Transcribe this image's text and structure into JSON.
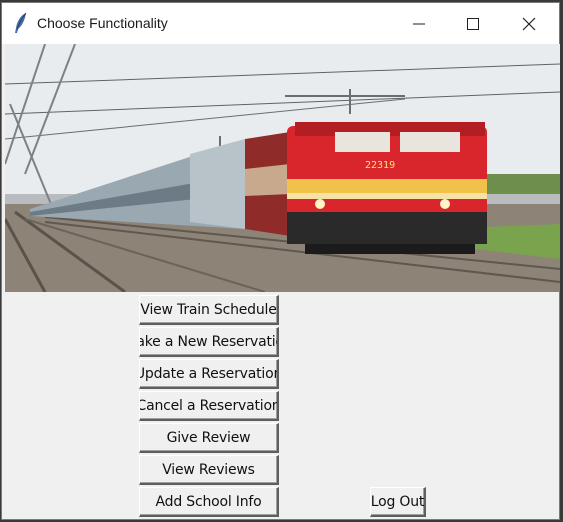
{
  "window": {
    "title": "Choose Functionality",
    "controls": {
      "minimize": "minimize-icon",
      "maximize": "maximize-icon",
      "close": "close-icon"
    }
  },
  "banner_image": {
    "alt_locomotive_number": "22319"
  },
  "menu": {
    "buttons": [
      {
        "label": "View Train Schedule"
      },
      {
        "label": "Make a New Reservation"
      },
      {
        "label": "Update a Reservation"
      },
      {
        "label": "Cancel a Reservation"
      },
      {
        "label": "Give Review"
      },
      {
        "label": "View Reviews"
      },
      {
        "label": "Add School Info"
      }
    ],
    "logout_label": "Log Out"
  },
  "colors": {
    "locomotive_red": "#d8262c",
    "locomotive_stripe": "#f2c14a",
    "window_bg": "#f0f0f0"
  }
}
